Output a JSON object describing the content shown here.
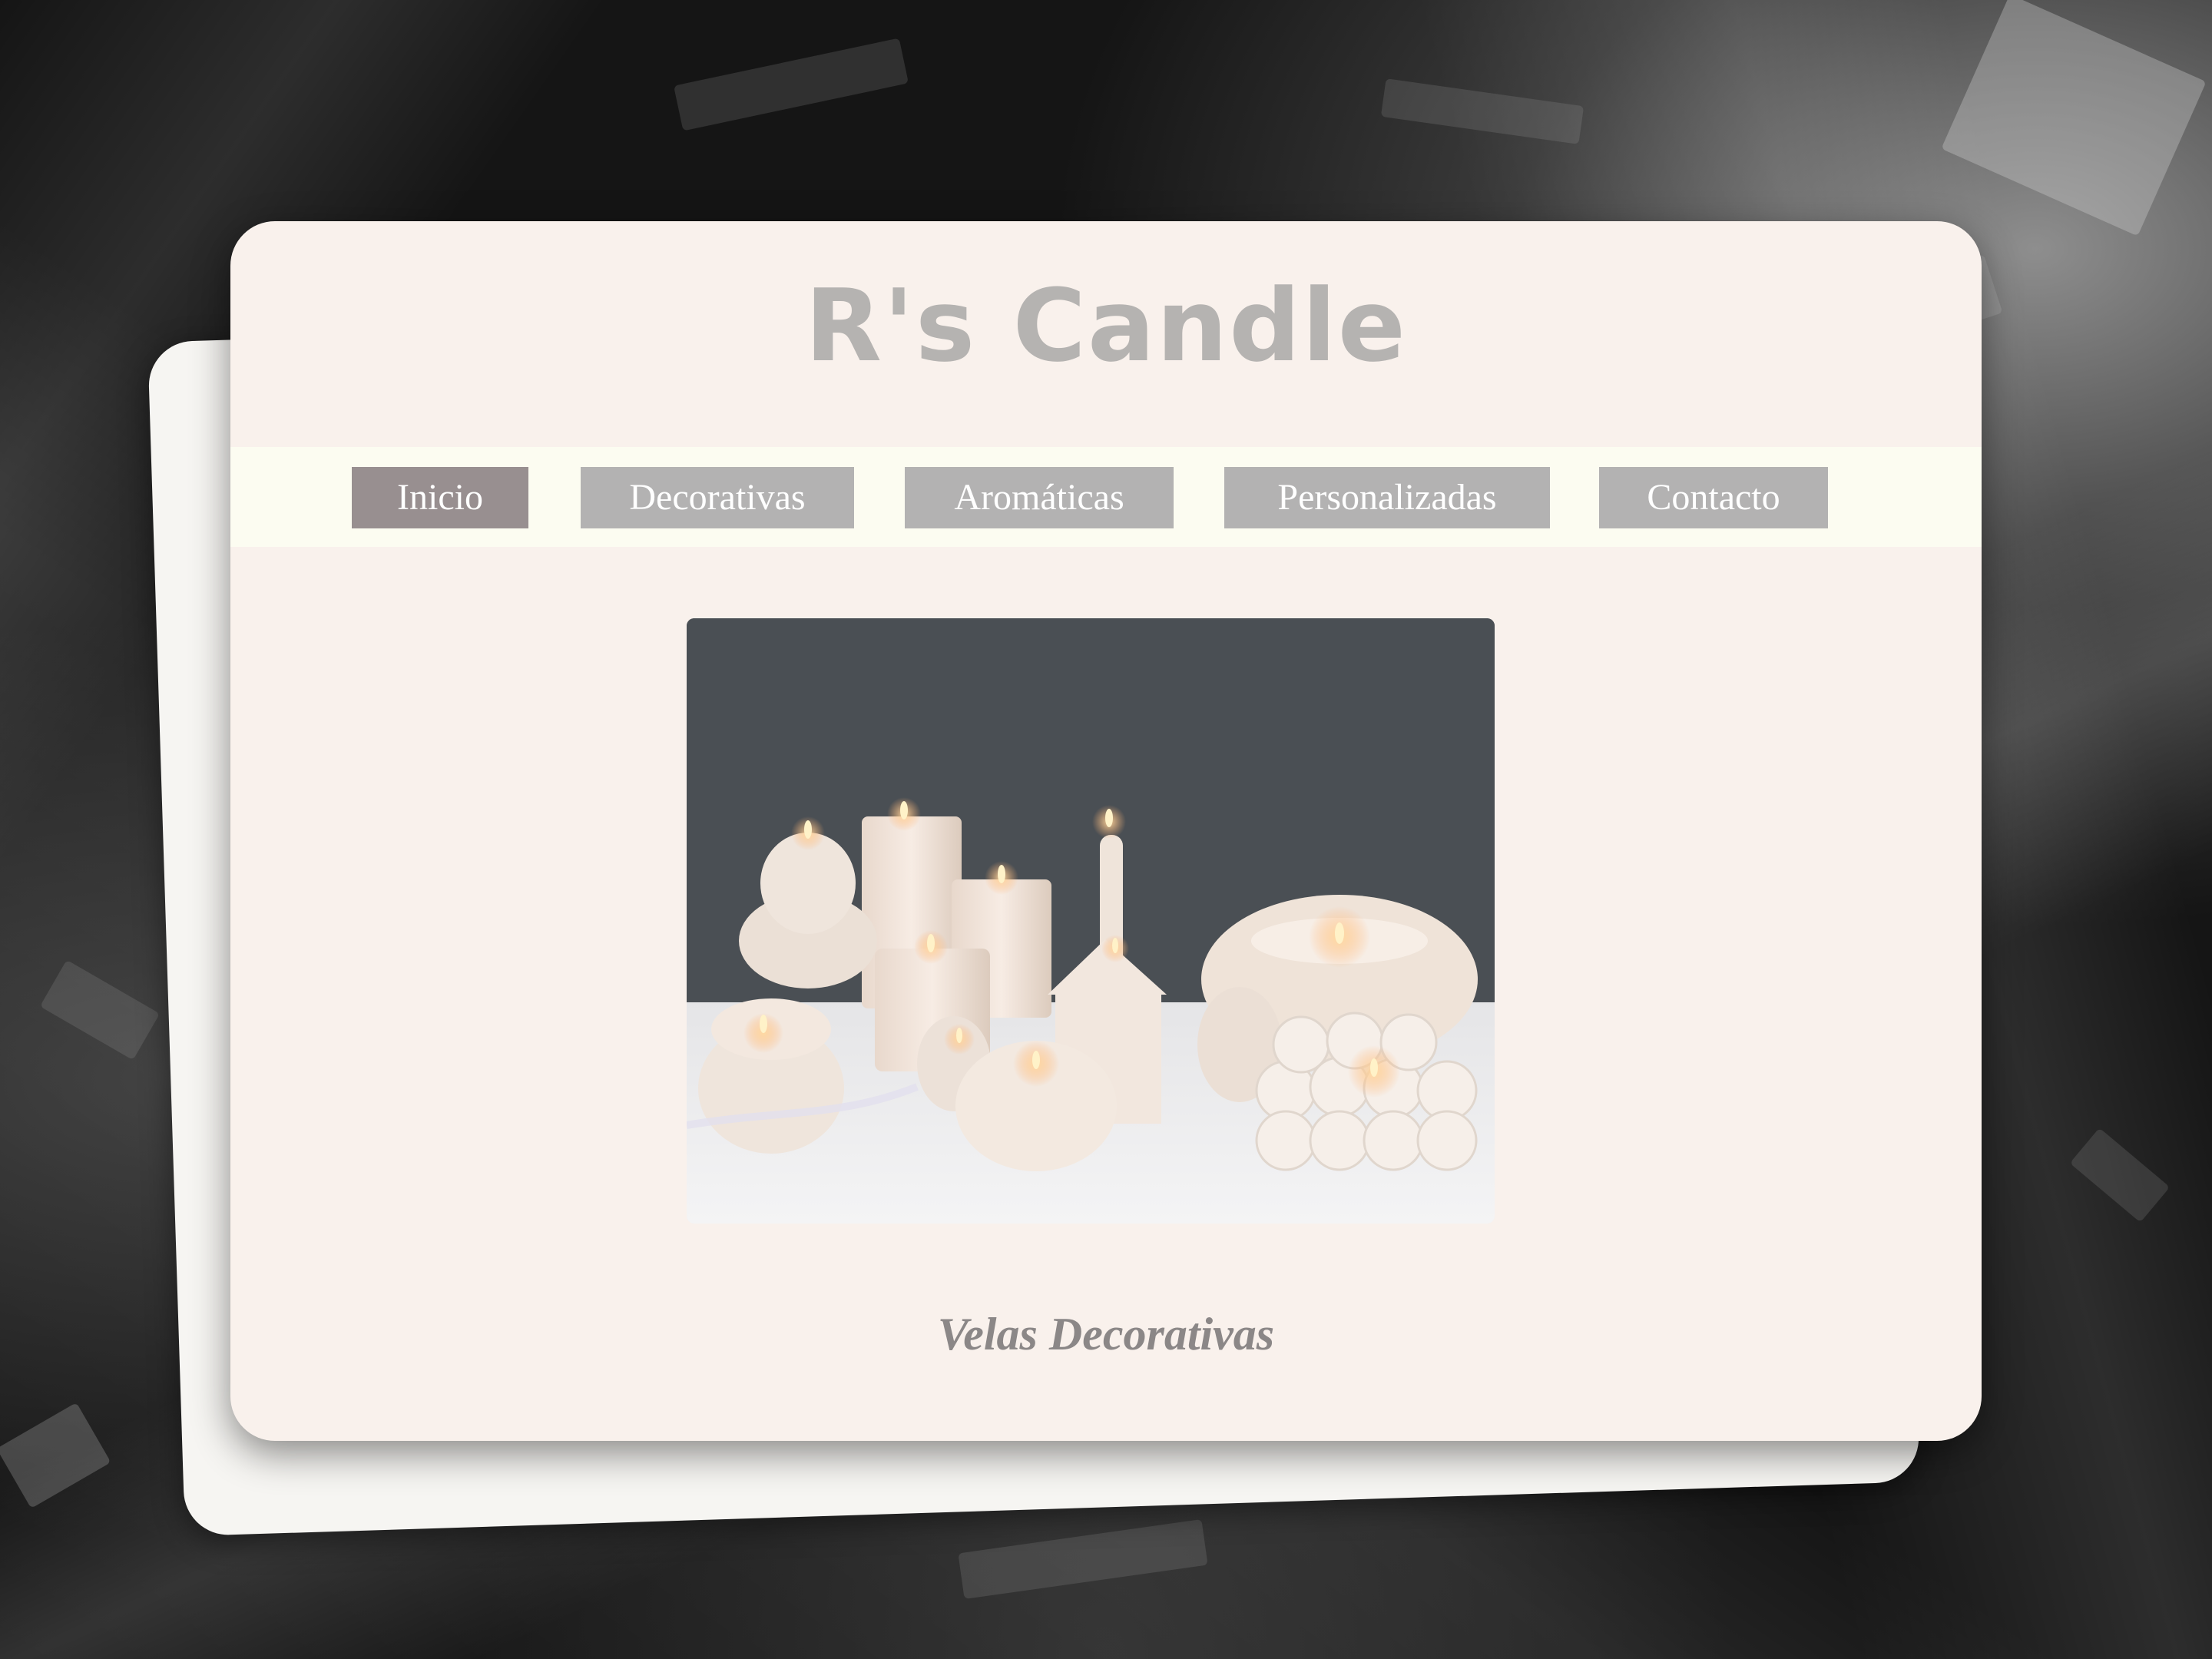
{
  "site": {
    "title": "R's Candle"
  },
  "nav": {
    "items": [
      {
        "label": "Inicio",
        "active": true
      },
      {
        "label": "Decorativas",
        "active": false
      },
      {
        "label": "Aromáticas",
        "active": false
      },
      {
        "label": "Personalizadas",
        "active": false
      },
      {
        "label": "Contacto",
        "active": false
      }
    ]
  },
  "hero": {
    "caption": "Velas Decorativas"
  },
  "colors": {
    "card_background": "#f9f1ec",
    "nav_bar": "#fcfcf1",
    "nav_button": "#b3b2b2",
    "nav_button_active": "#988f90",
    "title_text": "#b5b3b1",
    "caption_text": "#8b8787"
  }
}
